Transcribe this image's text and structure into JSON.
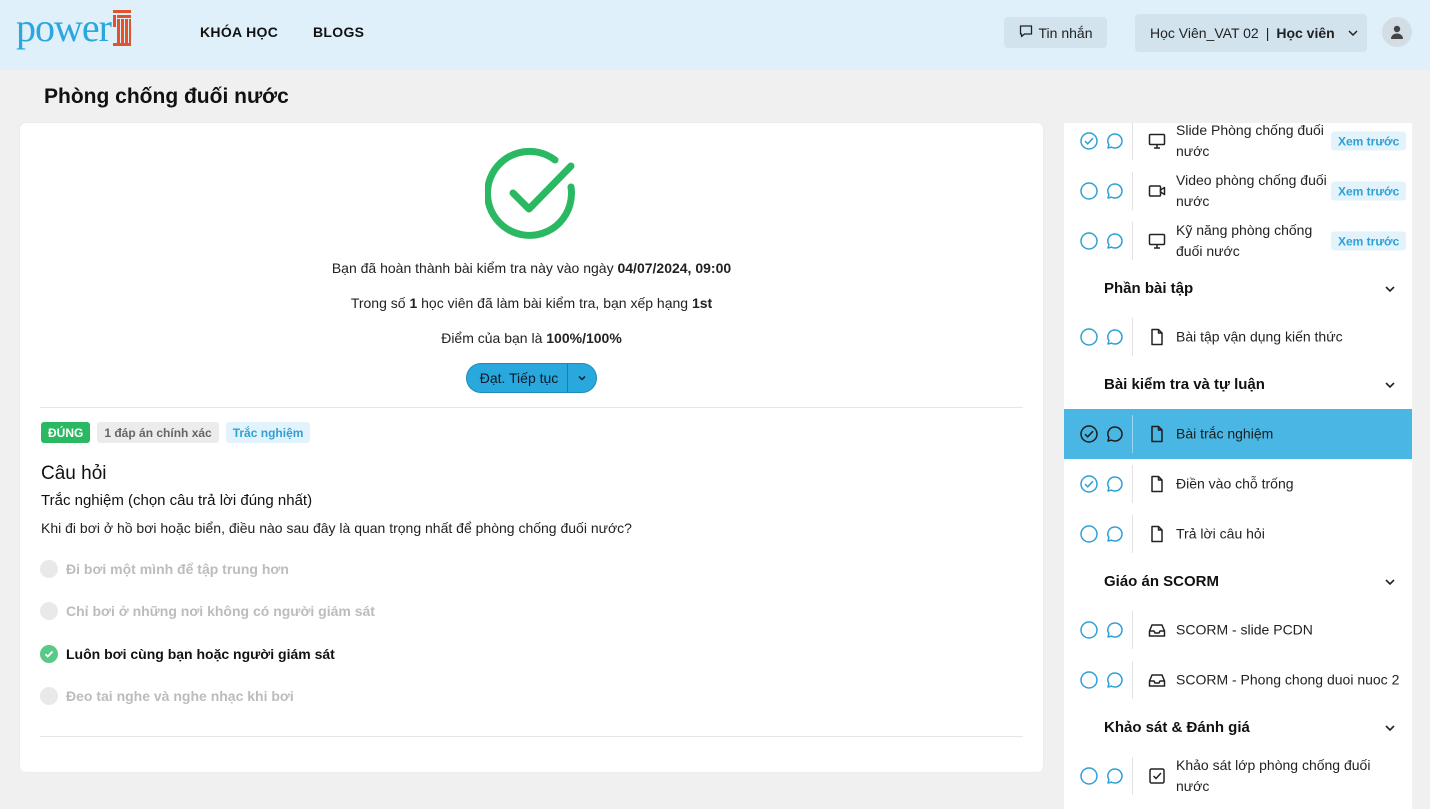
{
  "header": {
    "logo_text": "power",
    "nav": [
      "KHÓA HỌC",
      "BLOGS"
    ],
    "messages_label": "Tin nhắn",
    "user_name": "Học Viên_VAT 02",
    "user_separator": "|",
    "user_role": "Học viên"
  },
  "page_title": "Phòng chống đuối nước",
  "result": {
    "completed_prefix": "Bạn đã hoàn thành bài kiểm tra này vào ngày ",
    "completed_date": "04/07/2024, 09:00",
    "rank_prefix": "Trong số ",
    "rank_count": "1",
    "rank_middle": " học viên đã làm bài kiểm tra, bạn xếp hạng ",
    "rank_value": "1st",
    "score_prefix": "Điểm của bạn là ",
    "score_value": "100%/100%",
    "continue_label": "Đạt. Tiếp tục"
  },
  "question": {
    "tags": [
      "ĐÚNG",
      "1 đáp án chính xác",
      "Trắc nghiệm"
    ],
    "heading": "Câu hỏi",
    "subheading": "Trắc nghiệm (chọn câu trả lời đúng nhất)",
    "text": "Khi đi bơi ở hồ bơi hoặc biển, điều nào sau đây là quan trọng nhất để phòng chống đuối nước?",
    "options": [
      {
        "label": "Đi bơi một mình để tập trung hơn",
        "selected": false
      },
      {
        "label": "Chỉ bơi ở những nơi không có người giám sát",
        "selected": false
      },
      {
        "label": "Luôn bơi cùng bạn hoặc người giám sát",
        "selected": true
      },
      {
        "label": "Đeo tai nghe và nghe nhạc khi bơi",
        "selected": false
      }
    ]
  },
  "sidebar": {
    "preview_label": "Xem trước",
    "sections": [
      {
        "title": "Phần bài tập"
      },
      {
        "title": "Bài kiểm tra và tự luận"
      },
      {
        "title": "Giáo án SCORM"
      },
      {
        "title": "Khảo sát & Đánh giá"
      }
    ],
    "lessons": [
      {
        "title": "Slide Phòng chống đuối nước",
        "type": "monitor-icon",
        "done": true,
        "preview": true
      },
      {
        "title": "Video phòng chống đuối nước",
        "type": "video-icon",
        "done": false,
        "preview": true
      },
      {
        "title": "Kỹ năng phòng chống đuối nước",
        "type": "monitor-icon",
        "done": false,
        "preview": true
      },
      {
        "title": "Bài tập vận dụng kiến thức",
        "type": "document-icon",
        "done": false,
        "preview": false
      },
      {
        "title": "Bài trắc nghiệm",
        "type": "document-icon",
        "done": true,
        "preview": false,
        "active": true
      },
      {
        "title": "Điền vào chỗ trống",
        "type": "document-icon",
        "done": true,
        "preview": false
      },
      {
        "title": "Trả lời câu hỏi",
        "type": "document-icon",
        "done": false,
        "preview": false
      },
      {
        "title": "SCORM - slide PCDN",
        "type": "inbox-icon",
        "done": false,
        "preview": false
      },
      {
        "title": "SCORM - Phong chong duoi nuoc 2",
        "type": "inbox-icon",
        "done": false,
        "preview": false
      },
      {
        "title": "Khảo sát lớp phòng chống đuối nước",
        "type": "checkbox-icon",
        "done": false,
        "preview": false
      }
    ]
  },
  "colors": {
    "header_bg": "#dff0fa",
    "accent": "#29a8de",
    "success": "#2ab863",
    "active_row": "#4ab6e4"
  }
}
